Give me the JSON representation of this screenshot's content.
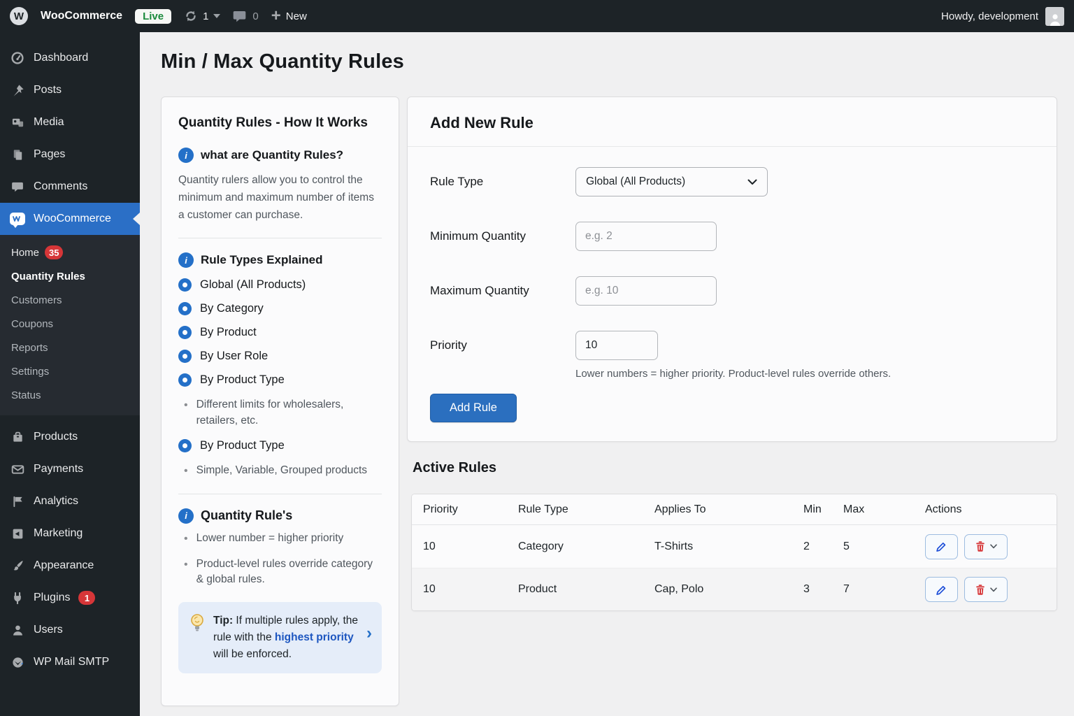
{
  "icons": {
    "info": "i",
    "wp_logo": "W",
    "plus": "+",
    "chevron_right": "›",
    "bullet": "•"
  },
  "topbar": {
    "site_name": "WooCommerce",
    "live_badge": "Live",
    "update_count": "1",
    "comment_count": "0",
    "new_label": "New",
    "howdy": "Howdy, development"
  },
  "sidebar": {
    "items": [
      {
        "label": "Dashboard"
      },
      {
        "label": "Posts"
      },
      {
        "label": "Media"
      },
      {
        "label": "Pages"
      },
      {
        "label": "Comments"
      },
      {
        "label": "WooCommerce"
      }
    ],
    "woocommerce_submenu": [
      {
        "label": "Home",
        "badge": "35"
      },
      {
        "label": "Quantity Rules"
      },
      {
        "label": "Customers"
      },
      {
        "label": "Coupons"
      },
      {
        "label": "Reports"
      },
      {
        "label": "Settings"
      },
      {
        "label": "Status"
      }
    ],
    "items_bottom": [
      {
        "label": "Products"
      },
      {
        "label": "Payments"
      },
      {
        "label": "Analytics"
      },
      {
        "label": "Marketing"
      },
      {
        "label": "Appearance"
      },
      {
        "label": "Plugins",
        "badge": "1"
      },
      {
        "label": "Users"
      },
      {
        "label": "WP Mail SMTP"
      }
    ]
  },
  "page": {
    "title": "Min / Max Quantity Rules"
  },
  "info_panel": {
    "title": "Quantity Rules - How It Works",
    "section1": {
      "heading": "what are Quantity Rules?",
      "body": "Quantity rulers allow you to control the minimum and maximum number of items a customer can purchase."
    },
    "section2": {
      "heading": "Rule Types Explained",
      "items": [
        "Global (All Products)",
        "By Category",
        "By Product",
        "By User Role",
        "By Product Type"
      ],
      "note1": "Different limits for wholesalers, retailers, etc.",
      "item_extra": "By Product Type",
      "note2": "Simple, Variable, Grouped products"
    },
    "section3": {
      "heading": "Quantity Rule's",
      "bullets": [
        "Lower number = higher priority",
        "Product-level rules override category & global rules."
      ]
    },
    "tip": {
      "label": "Tip:",
      "text1": " If multiple rules apply, the rule with the ",
      "highlight": "highest priority",
      "text2": " will be enforced."
    }
  },
  "form": {
    "title": "Add New Rule",
    "rule_type": {
      "label": "Rule Type",
      "value": "Global (All Products)"
    },
    "min_qty": {
      "label": "Minimum Quantity",
      "placeholder": "e.g. 2"
    },
    "max_qty": {
      "label": "Maximum Quantity",
      "placeholder": "e.g. 10"
    },
    "priority": {
      "label": "Priority",
      "value": "10",
      "help": "Lower numbers = higher priority. Product-level rules override others."
    },
    "submit_label": "Add Rule"
  },
  "active_rules": {
    "title": "Active Rules",
    "columns": [
      "Priority",
      "Rule Type",
      "Applies To",
      "Min",
      "Max",
      "Actions"
    ],
    "rows": [
      {
        "priority": "10",
        "rule_type": "Category",
        "applies_to": "T-Shirts",
        "min": "2",
        "max": "5"
      },
      {
        "priority": "10",
        "rule_type": "Product",
        "applies_to": "Cap, Polo",
        "min": "3",
        "max": "7"
      }
    ]
  },
  "colors": {
    "admin_dark": "#1d2327",
    "accent_blue": "#2b6fc6",
    "badge_red": "#d63638",
    "live_green": "#1a8a3c",
    "content_bg": "#f0f0f1"
  }
}
